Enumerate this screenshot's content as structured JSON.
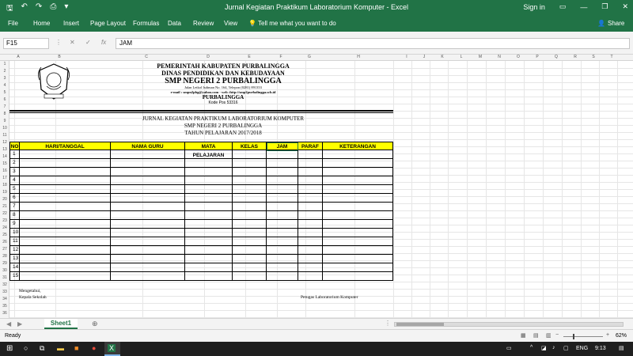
{
  "app": {
    "title": "Jurnal Kegiatan Praktikum Laboratorium Komputer  -  Excel",
    "signin": "Sign in",
    "share_label": "Share"
  },
  "ribbon": {
    "tabs": [
      "File",
      "Home",
      "Insert",
      "Page Layout",
      "Formulas",
      "Data",
      "Review",
      "View"
    ],
    "tell_me": "Tell me what you want to do"
  },
  "formula_bar": {
    "name_box": "F15",
    "content": "JAM"
  },
  "columns": [
    "A",
    "B",
    "C",
    "D",
    "E",
    "F",
    "G",
    "H",
    "I",
    "J",
    "K",
    "L",
    "M",
    "N",
    "O",
    "P",
    "Q",
    "R",
    "S",
    "T"
  ],
  "rows": [
    "1",
    "2",
    "3",
    "4",
    "5",
    "6",
    "7",
    "8",
    "9",
    "10",
    "11",
    "12",
    "13",
    "14",
    "15",
    "16",
    "17",
    "18",
    "19",
    "20",
    "21",
    "22",
    "23",
    "24",
    "25",
    "26",
    "27",
    "28",
    "29",
    "30",
    "31",
    "32",
    "33",
    "34",
    "35",
    "36"
  ],
  "letterhead": {
    "line1": "PEMERINTAH KABUPATEN PURBALINGGA",
    "line2": "DINAS PENDIDIKAN DAN KEBUDAYAAN",
    "line3": "SMP NEGERI 2 PURBALINGGA",
    "address": "Jalan Letkol Isdiman No. 164, Telepon  (0281) 891353",
    "email": "e-mail : smpn2pbg@yahoo.com -  web :http://smp2purbalingga.sch.id",
    "city": "PURBALINGGA",
    "postcode": "Kode Pos 53316"
  },
  "journal": {
    "title": "JURNAL KEGIATAN PRAKTIKUM LABORATORIUM KOMPUTER",
    "school": "SMP NEGERI 2 PURBALINGGA",
    "year": "TAHUN PELAJARAN 2017/2018"
  },
  "table": {
    "headers": [
      "NO",
      "HARI/TANGGAL",
      "NAMA GURU",
      "MATA PELAJARAN",
      "KELAS",
      "JAM",
      "PARAF",
      "KETERANGAN"
    ],
    "row_numbers": [
      "1",
      "2",
      "3",
      "4",
      "5",
      "6",
      "7",
      "8",
      "9",
      "10",
      "11",
      "12",
      "13",
      "14",
      "15"
    ]
  },
  "footer": {
    "left1": "Mengetahui,",
    "left2": "Kepala Sekolah",
    "right": "Petugas Laboratorium Komputer"
  },
  "sheet_tab": "Sheet1",
  "status": {
    "ready": "Ready",
    "zoom": "62%"
  },
  "taskbar": {
    "lang": "ENG",
    "time": "9:13"
  }
}
